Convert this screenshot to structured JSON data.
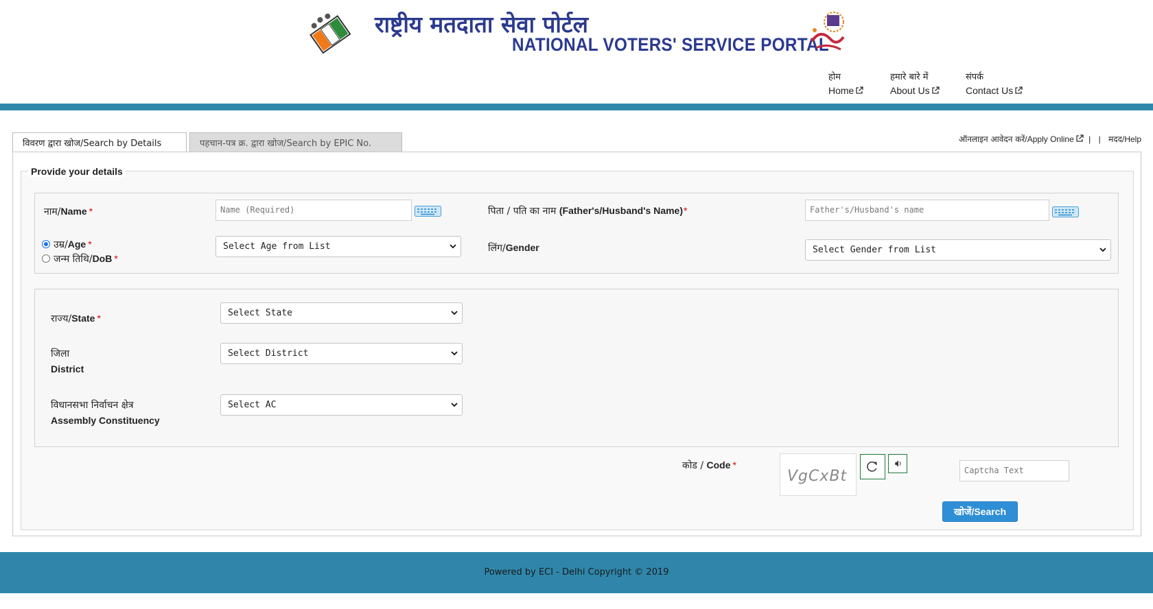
{
  "header": {
    "title_hindi": "राष्ट्रीय मतदाता सेवा पोर्टल",
    "title_english": "NATIONAL VOTERS' SERVICE PORTAL"
  },
  "nav": {
    "items": [
      {
        "hindi": "होम",
        "english": "Home"
      },
      {
        "hindi": "हमारे बारे में",
        "english": "About Us"
      },
      {
        "hindi": "संपर्क",
        "english": "Contact Us"
      }
    ]
  },
  "tabs": [
    {
      "label": "विवरण द्वारा खोज/Search by Details",
      "active": true
    },
    {
      "label": "पहचान-पत्र क्र. द्वारा खोज/Search by EPIC No.",
      "active": false
    }
  ],
  "top_links": {
    "apply_hindi": "ऑनलाइन आवेदन करें",
    "apply_english": "/Apply Online",
    "sep": "|",
    "help_hindi": "मदद",
    "help_english": "/Help"
  },
  "form": {
    "legend": "Provide your details",
    "name": {
      "label_hindi": "नाम/",
      "label_english": "Name",
      "placeholder": "Name (Required)"
    },
    "father": {
      "label_hindi": "पिता / पति का नाम ",
      "label_english": "(Father's/Husband's Name)",
      "placeholder": "Father's/Husband's name"
    },
    "age": {
      "label_hindi": "उम्र/",
      "label_english": "Age",
      "select_value": "Select Age from List"
    },
    "dob": {
      "label_hindi": "जन्म तिथि/",
      "label_english": "DoB"
    },
    "gender": {
      "label_hindi": "लिंग/",
      "label_english": "Gender",
      "select_value": "Select Gender from List"
    },
    "state": {
      "label_hindi": "राज्य/",
      "label_english": "State",
      "select_value": "Select State"
    },
    "district": {
      "label_hindi": "जिला",
      "label_english": "District",
      "select_value": "Select District"
    },
    "ac": {
      "label_hindi": "विधानसभा निर्वाचन क्षेत्र",
      "label_english": "Assembly Constituency",
      "select_value": "Select AC"
    },
    "code": {
      "label_hindi": "कोड / ",
      "label_english": "Code",
      "captcha_text": "VgCxBt",
      "placeholder": "Captcha Text"
    },
    "required_mark": "*",
    "search_hindi": "खोजें",
    "search_english": "/Search"
  },
  "footer": {
    "text": "Powered by ECI - Delhi Copyright © 2019"
  },
  "colors": {
    "brand_blue": "#2b3a8f",
    "bar_teal": "#2f86aa",
    "button_blue": "#2f8fd6",
    "required_red": "#dd0000"
  }
}
